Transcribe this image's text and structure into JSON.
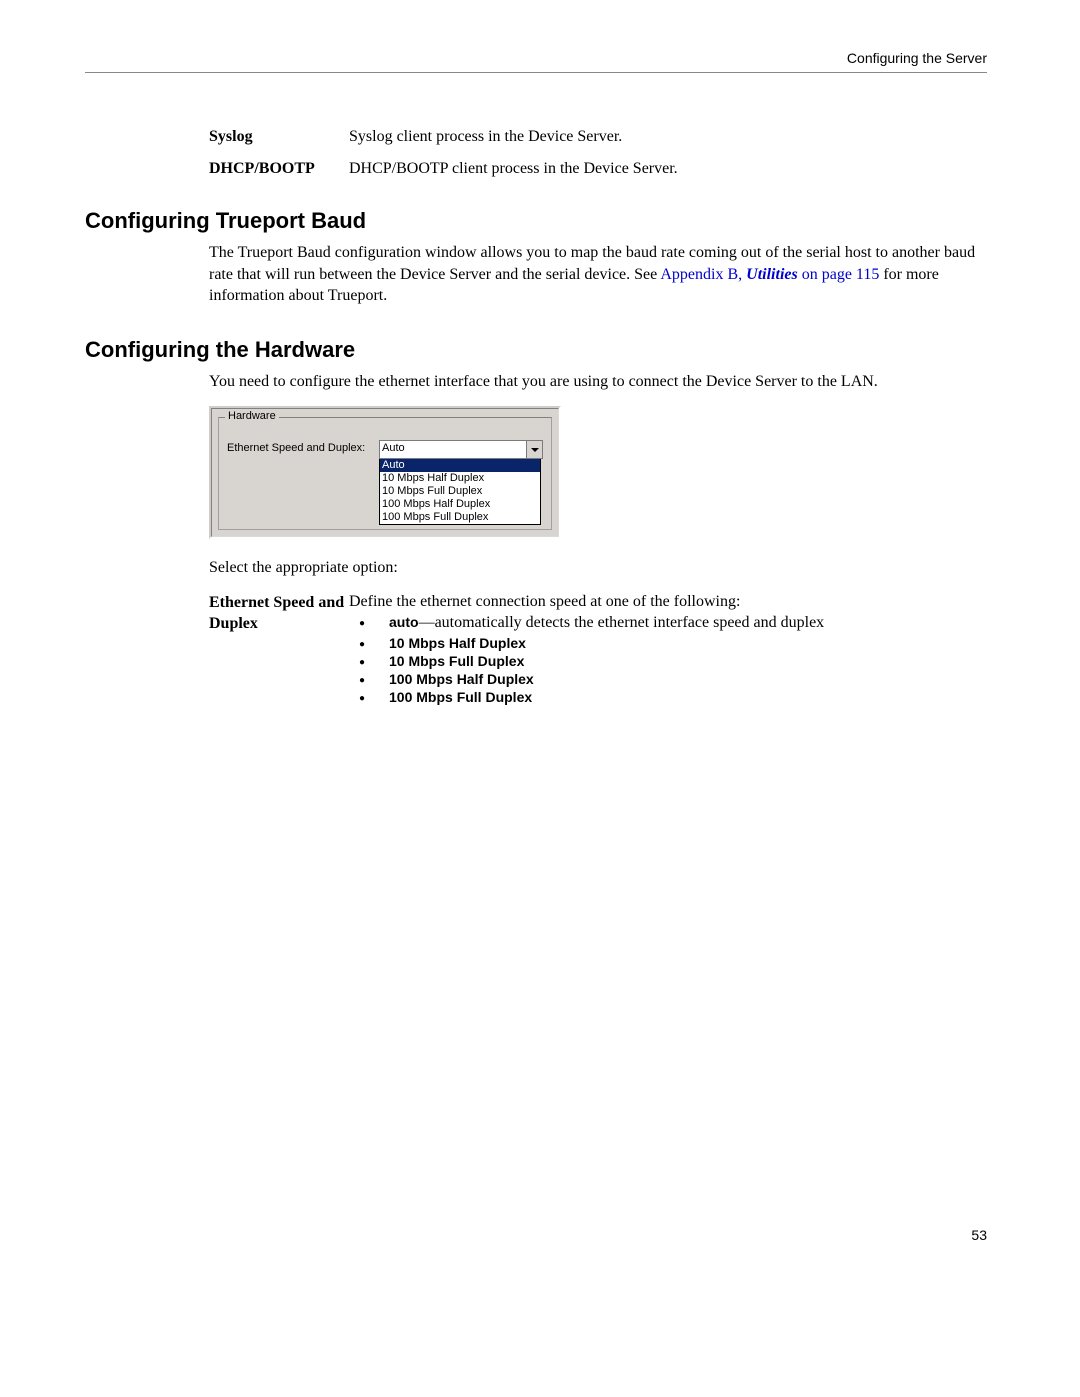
{
  "header": {
    "running_title": "Configuring the Server"
  },
  "def_rows": [
    {
      "term": "Syslog",
      "desc": "Syslog client process in the Device Server."
    },
    {
      "term": "DHCP/BOOTP",
      "desc": "DHCP/BOOTP client process in the Device Server."
    }
  ],
  "sections": {
    "trueport": {
      "heading": "Configuring Trueport Baud",
      "para_pre": "The Trueport Baud configuration window allows you to map the baud rate coming out of the serial host to another baud rate that will run between the Device Server and the serial device. See ",
      "link_prefix": "Appendix B, ",
      "link_italic": "Utilities",
      "link_suffix": " on page 115",
      "para_post": " for more information about Trueport."
    },
    "hardware": {
      "heading": "Configuring the Hardware",
      "para": "You need to configure the ethernet interface that you are using to connect the Device Server to the LAN.",
      "dialog": {
        "group_title": "Hardware",
        "label": "Ethernet Speed and Duplex:",
        "selected_value": "Auto",
        "options": [
          "Auto",
          "10 Mbps Half Duplex",
          "10 Mbps Full Duplex",
          "100 Mbps Half Duplex",
          "100 Mbps Full Duplex"
        ],
        "selected_index": 0
      },
      "select_prompt": "Select the appropriate option:",
      "eth_def": {
        "term": "Ethernet Speed and Duplex",
        "intro": "Define the ethernet connection speed at one of the following:",
        "options": [
          {
            "bold": "auto",
            "desc": "—automatically detects the ethernet interface speed and duplex"
          },
          {
            "bold": "10 Mbps Half Duplex",
            "desc": ""
          },
          {
            "bold": "10 Mbps Full Duplex",
            "desc": ""
          },
          {
            "bold": "100 Mbps Half Duplex",
            "desc": ""
          },
          {
            "bold": "100 Mbps Full Duplex",
            "desc": ""
          }
        ]
      }
    }
  },
  "page_number": "53"
}
